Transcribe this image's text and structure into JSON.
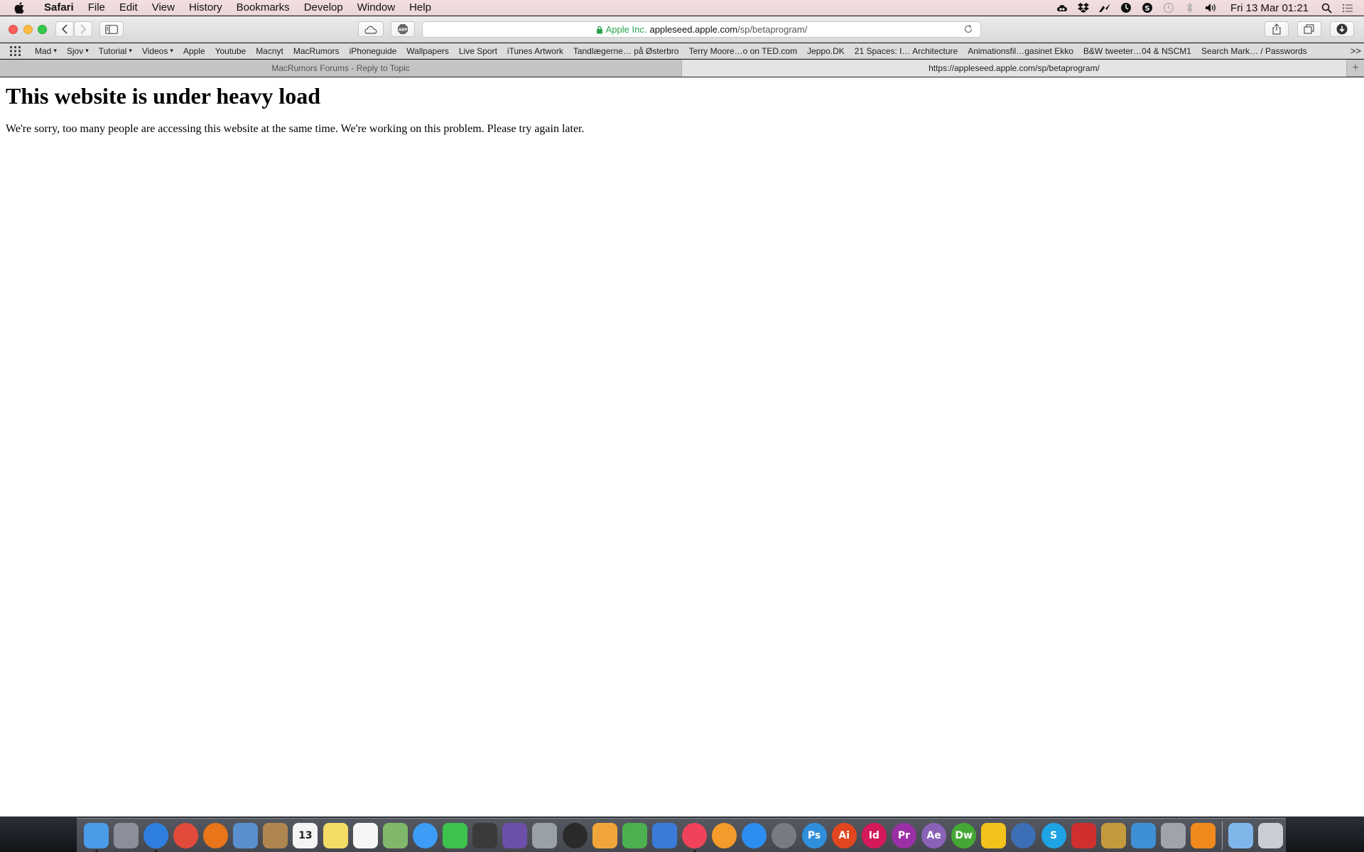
{
  "menubar": {
    "app_name": "Safari",
    "items": [
      "File",
      "Edit",
      "View",
      "History",
      "Bookmarks",
      "Develop",
      "Window",
      "Help"
    ],
    "clock": "Fri 13 Mar  01:21"
  },
  "toolbar": {
    "address": {
      "secure_label": "Apple Inc.",
      "host": "appleseed.apple.com",
      "path": "/sp/betaprogram/"
    }
  },
  "bookmarks": {
    "items": [
      {
        "label": "Mad",
        "folder": true
      },
      {
        "label": "Sjov",
        "folder": true
      },
      {
        "label": "Tutorial",
        "folder": true
      },
      {
        "label": "Videos",
        "folder": true
      },
      {
        "label": "Apple",
        "folder": false
      },
      {
        "label": "Youtube",
        "folder": false
      },
      {
        "label": "Macnyt",
        "folder": false
      },
      {
        "label": "MacRumors",
        "folder": false
      },
      {
        "label": "iPhoneguide",
        "folder": false
      },
      {
        "label": "Wallpapers",
        "folder": false
      },
      {
        "label": "Live Sport",
        "folder": false
      },
      {
        "label": "iTunes Artwork",
        "folder": false
      },
      {
        "label": "Tandlægerne… på Østerbro",
        "folder": false
      },
      {
        "label": "Terry Moore…o on TED.com",
        "folder": false
      },
      {
        "label": "Jeppo.DK",
        "folder": false
      },
      {
        "label": "21 Spaces: I… Architecture",
        "folder": false
      },
      {
        "label": "Animationsfil…gasinet Ekko",
        "folder": false
      },
      {
        "label": "B&W tweeter…04 & NSCM1",
        "folder": false
      },
      {
        "label": "Search Mark… / Passwords",
        "folder": false
      }
    ],
    "more": ">>"
  },
  "tabs": [
    {
      "title": "MacRumors Forums - Reply to Topic",
      "active": false
    },
    {
      "title": "https://appleseed.apple.com/sp/betaprogram/",
      "active": true
    }
  ],
  "new_tab_label": "+",
  "page": {
    "heading": "This website is under heavy load",
    "message": "We're sorry, too many people are accessing this website at the same time. We're working on this problem. Please try again later."
  },
  "dock": {
    "apps": [
      {
        "name": "finder",
        "glyph": "",
        "color": "#4a9be8",
        "running": true
      },
      {
        "name": "launchpad",
        "glyph": "",
        "color": "#8a8f99",
        "running": false
      },
      {
        "name": "safari",
        "glyph": "",
        "color": "#2f7fe0",
        "running": true
      },
      {
        "name": "chrome",
        "glyph": "",
        "color": "#e24b3b",
        "running": false
      },
      {
        "name": "firefox",
        "glyph": "",
        "color": "#e8751a",
        "running": false
      },
      {
        "name": "preview",
        "glyph": "",
        "color": "#5a8fcf",
        "running": false
      },
      {
        "name": "contacts",
        "glyph": "",
        "color": "#b08650",
        "running": false
      },
      {
        "name": "calendar",
        "glyph": "13",
        "color": "#f4f4f4",
        "running": false
      },
      {
        "name": "notes",
        "glyph": "",
        "color": "#f4dc66",
        "running": false
      },
      {
        "name": "reminders",
        "glyph": "",
        "color": "#f6f6f6",
        "running": false
      },
      {
        "name": "maps",
        "glyph": "",
        "color": "#7fb86a",
        "running": false
      },
      {
        "name": "messages",
        "glyph": "",
        "color": "#3d9cf5",
        "running": false
      },
      {
        "name": "facetime",
        "glyph": "",
        "color": "#3cc24d",
        "running": false
      },
      {
        "name": "final-cut-pro",
        "glyph": "",
        "color": "#3a3a3a",
        "running": false
      },
      {
        "name": "motion",
        "glyph": "",
        "color": "#6b4fa8",
        "running": false
      },
      {
        "name": "compressor",
        "glyph": "",
        "color": "#9aa0a8",
        "running": false
      },
      {
        "name": "aperture",
        "glyph": "",
        "color": "#2a2a2a",
        "running": false
      },
      {
        "name": "pages",
        "glyph": "",
        "color": "#f0a53a",
        "running": false
      },
      {
        "name": "numbers",
        "glyph": "",
        "color": "#4caf50",
        "running": false
      },
      {
        "name": "keynote",
        "glyph": "",
        "color": "#3b7bd8",
        "running": false
      },
      {
        "name": "itunes",
        "glyph": "",
        "color": "#f0435a",
        "running": true
      },
      {
        "name": "ibooks",
        "glyph": "",
        "color": "#f59b2b",
        "running": false
      },
      {
        "name": "app-store",
        "glyph": "",
        "color": "#2b8ef0",
        "running": false
      },
      {
        "name": "system-preferences",
        "glyph": "",
        "color": "#777c84",
        "running": false
      },
      {
        "name": "photoshop",
        "glyph": "Ps",
        "color": "#2f8fdc",
        "running": false
      },
      {
        "name": "illustrator",
        "glyph": "Ai",
        "color": "#e2461f",
        "running": false
      },
      {
        "name": "indesign",
        "glyph": "Id",
        "color": "#d6195a",
        "running": false
      },
      {
        "name": "premiere",
        "glyph": "Pr",
        "color": "#9b2fa6",
        "running": false
      },
      {
        "name": "after-effects",
        "glyph": "Ae",
        "color": "#8a62b8",
        "running": false
      },
      {
        "name": "dreamweaver",
        "glyph": "Dw",
        "color": "#45a834",
        "running": false
      },
      {
        "name": "cyberduck",
        "glyph": "",
        "color": "#f3c21b",
        "running": false
      },
      {
        "name": "1password",
        "glyph": "",
        "color": "#3d6fb6",
        "running": false
      },
      {
        "name": "skype",
        "glyph": "S",
        "color": "#1ea3e4",
        "running": false
      },
      {
        "name": "transmission",
        "glyph": "",
        "color": "#cf2f2f",
        "running": false
      },
      {
        "name": "unarchiver",
        "glyph": "",
        "color": "#c49b3c",
        "running": false
      },
      {
        "name": "screen-sharing",
        "glyph": "",
        "color": "#3f8fd6",
        "running": false
      },
      {
        "name": "logic",
        "glyph": "",
        "color": "#a0a4aa",
        "running": false
      },
      {
        "name": "vlc",
        "glyph": "",
        "color": "#f08a1c",
        "running": false
      }
    ],
    "stacks": [
      {
        "name": "downloads-folder",
        "color": "#7fb6ea"
      },
      {
        "name": "trash",
        "color": "#c9ced6"
      }
    ]
  }
}
